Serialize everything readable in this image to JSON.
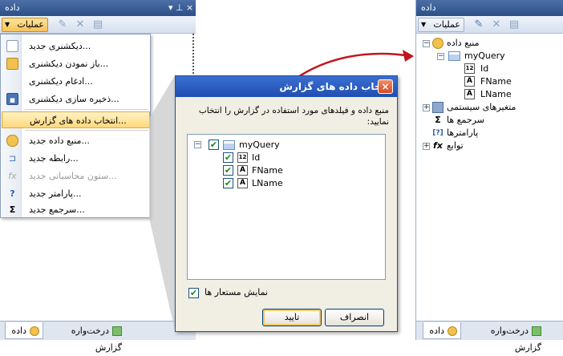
{
  "left_panel": {
    "title": "داده",
    "pin": "▾ ⊥",
    "close": "×",
    "ops_button": "عملیات",
    "menu": [
      {
        "label": "...دیکشنری جدید",
        "icon": "new-dictionary-icon",
        "state": "normal"
      },
      {
        "label": "...باز نمودن دیکشنری",
        "icon": "open-folder-icon",
        "state": "normal"
      },
      {
        "label": "...ادغام دیکشنری",
        "icon": "merge-icon",
        "state": "normal"
      },
      {
        "label": "...ذخیره سازی دیکشنری",
        "icon": "save-icon",
        "state": "normal"
      },
      {
        "label": "...انتخاب داده های گزارش",
        "icon": "select-data-icon",
        "state": "highlighted"
      },
      {
        "label": "...منبع داده جدید",
        "icon": "database-icon",
        "state": "normal"
      },
      {
        "label": "...رابطه جدید",
        "icon": "relation-icon",
        "state": "normal"
      },
      {
        "label": "...ستون محاسباتی جدید",
        "icon": "calc-column-icon",
        "state": "disabled"
      },
      {
        "label": "...پارامتر جدید",
        "icon": "parameter-icon",
        "state": "normal"
      },
      {
        "label": "...سرجمع جدید",
        "icon": "sum-icon",
        "state": "normal"
      }
    ],
    "tabs": [
      {
        "label": "داده",
        "active": true
      },
      {
        "label": "درخت‌واره گزارش",
        "active": false
      }
    ]
  },
  "dialog": {
    "title": "انتخاب داده های گزارش",
    "close": "×",
    "description": "منبع داده و فیلدهای مورد استفاده در گزارش را انتخاب نمایید:",
    "tree": {
      "source": "myQuery",
      "fields": [
        {
          "name": "Id",
          "icon": "12"
        },
        {
          "name": "FName",
          "icon": "A"
        },
        {
          "name": "LName",
          "icon": "A"
        }
      ]
    },
    "show_aliases_label": "نمایش مستعار ها",
    "ok_label": "تایید",
    "cancel_label": "انصراف"
  },
  "right_panel": {
    "title": "داده",
    "ops_button": "عملیات",
    "tree": [
      {
        "label": "منبع داده",
        "level": 0,
        "toggle": "-",
        "icon": "database-icon"
      },
      {
        "label": "myQuery",
        "level": 1,
        "toggle": "-",
        "icon": "table-icon"
      },
      {
        "label": "Id",
        "level": 2,
        "icon": "12"
      },
      {
        "label": "FName",
        "level": 2,
        "icon": "A"
      },
      {
        "label": "LName",
        "level": 2,
        "icon": "A"
      },
      {
        "label": "متغیرهای سیستمی",
        "level": 0,
        "toggle": "+",
        "icon": "system-vars-icon"
      },
      {
        "label": "سرجمع ها",
        "level": 0,
        "icon": "Σ"
      },
      {
        "label": "پارامترها",
        "level": 0,
        "icon": "[?]"
      },
      {
        "label": "توابع",
        "level": 0,
        "toggle": "+",
        "icon": "fx"
      }
    ],
    "tabs": [
      {
        "label": "داده",
        "active": true
      },
      {
        "label": "درخت‌واره گزارش",
        "active": false
      }
    ]
  },
  "colors": {
    "title_bar": "#2c4f86",
    "highlight": "#ffd87a",
    "dialog_title": "#1f4fb0",
    "annotation_red": "#c0171f"
  }
}
